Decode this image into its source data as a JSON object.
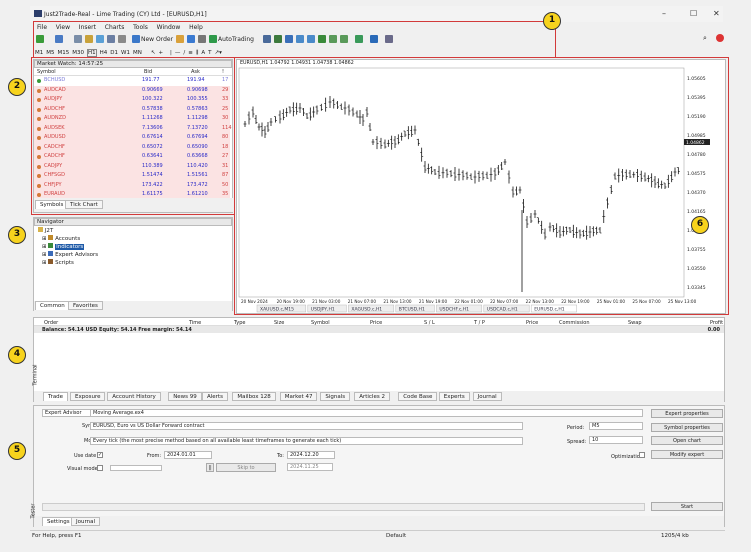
{
  "window": {
    "title": "Just2Trade-Real - Lime Trading (CY) Ltd - [EURUSD,H1]"
  },
  "menu": [
    "File",
    "View",
    "Insert",
    "Charts",
    "Tools",
    "Window",
    "Help"
  ],
  "toolbar": {
    "new_order": "New Order",
    "autotrading": "AutoTrading",
    "timeframes": [
      "M1",
      "M5",
      "M15",
      "M30",
      "H1",
      "H4",
      "D1",
      "W1",
      "MN"
    ]
  },
  "market_watch": {
    "title": "Market Watch: 14:57:25",
    "cols": [
      "Symbol",
      "Bid",
      "Ask",
      "!"
    ],
    "rows": [
      {
        "sym": "BCHUSD",
        "bid": "191.77",
        "ask": "191.94",
        "sp": "17"
      },
      {
        "sym": "AUDCAD",
        "bid": "0.90669",
        "ask": "0.90698",
        "sp": "29"
      },
      {
        "sym": "AUDJPY",
        "bid": "100.322",
        "ask": "100.355",
        "sp": "33"
      },
      {
        "sym": "AUDCHF",
        "bid": "0.57838",
        "ask": "0.57863",
        "sp": "25"
      },
      {
        "sym": "AUDNZD",
        "bid": "1.11268",
        "ask": "1.11298",
        "sp": "30"
      },
      {
        "sym": "AUDSEK",
        "bid": "7.13606",
        "ask": "7.13720",
        "sp": "114"
      },
      {
        "sym": "AUDUSD",
        "bid": "0.67614",
        "ask": "0.67694",
        "sp": "80"
      },
      {
        "sym": "CADCHF",
        "bid": "0.65072",
        "ask": "0.65090",
        "sp": "18"
      },
      {
        "sym": "CADCHF",
        "bid": "0.63641",
        "ask": "0.63668",
        "sp": "27"
      },
      {
        "sym": "CADJPY",
        "bid": "110.389",
        "ask": "110.420",
        "sp": "31"
      },
      {
        "sym": "CHFSGD",
        "bid": "1.51474",
        "ask": "1.51561",
        "sp": "87"
      },
      {
        "sym": "CHFJPY",
        "bid": "173.422",
        "ask": "173.472",
        "sp": "50"
      },
      {
        "sym": "EURAUD",
        "bid": "1.61175",
        "ask": "1.61210",
        "sp": "35"
      }
    ],
    "tabs": [
      "Symbols",
      "Tick Chart"
    ]
  },
  "navigator": {
    "title": "Navigator",
    "root": "J2T",
    "items": [
      "Accounts",
      "Indicators",
      "Expert Advisors",
      "Scripts"
    ],
    "tabs": [
      "Common",
      "Favorites"
    ]
  },
  "chart": {
    "header": "EURUSD,H1  1.04792 1.04931 1.04738 1.04862",
    "current_price": "1.04862",
    "y_labels": [
      "1.05605",
      "1.05395",
      "1.05190",
      "1.04985",
      "1.04780",
      "1.04575",
      "1.04370",
      "1.04165",
      "1.03960",
      "1.03755",
      "1.03550",
      "1.03345"
    ],
    "x_labels": [
      "20 Nov 2024",
      "20 Nov 19:00",
      "21 Nov 03:00",
      "21 Nov 07:00",
      "21 Nov 13:00",
      "21 Nov 19:00",
      "22 Nov 01:00",
      "22 Nov 07:00",
      "22 Nov 13:00",
      "22 Nov 19:00",
      "25 Nov 01:00",
      "25 Nov 07:00",
      "25 Nov 13:00"
    ],
    "tabs": [
      "XAUUSD.c,M15",
      "USDJPY,H1",
      "XAGUSD.c,H1",
      "BTCUSD,H1",
      "USDCHF.c,H1",
      "USDCAD.c,H1",
      "EURUSD.c,H1"
    ]
  },
  "terminal": {
    "cols": [
      "Order",
      "Time",
      "Type",
      "Size",
      "Symbol",
      "Price",
      "S / L",
      "T / P",
      "Price",
      "Commission",
      "Swap",
      "Profit"
    ],
    "balance": "Balance: 54.14 USD  Equity: 54.14  Free margin: 54.14",
    "profit": "0.00",
    "side": "Terminal",
    "tabs": [
      "Trade",
      "Exposure",
      "Account History",
      "News 99",
      "Alerts",
      "Mailbox 128",
      "Market 47",
      "Signals",
      "Articles 2",
      "Code Base",
      "Experts",
      "Journal"
    ]
  },
  "tester": {
    "type": "Expert Advisor",
    "ea": "Moving Average.ex4",
    "symbol_label": "Symbol",
    "symbol": "EURUSD, Euro vs US Dollar Forward contract",
    "model_label": "Model",
    "model": "Every tick (the most precise method based on all available least timeframes to generate each tick)",
    "use_date": "Use date",
    "from_label": "From:",
    "from": "2024.01.01",
    "to_label": "To:",
    "to": "2024.12.20",
    "visual": "Visual mode",
    "skip": "Skip to",
    "skip_date": "2024.11.25",
    "period_label": "Period:",
    "period": "M5",
    "spread_label": "Spread:",
    "spread": "10",
    "optimization": "Optimization",
    "btns": [
      "Expert properties",
      "Symbol properties",
      "Open chart",
      "Modify expert"
    ],
    "start": "Start",
    "tabs": [
      "Settings",
      "Journal"
    ],
    "side": "Tester"
  },
  "status": {
    "help": "For Help, press F1",
    "profile": "Default",
    "traffic": "1205/4 kb"
  },
  "callouts": [
    "1",
    "2",
    "3",
    "4",
    "5",
    "6"
  ],
  "colors": {
    "accent": "#1e5aa8",
    "callout": "#f7d31d",
    "highlight": "#d23a3a"
  }
}
